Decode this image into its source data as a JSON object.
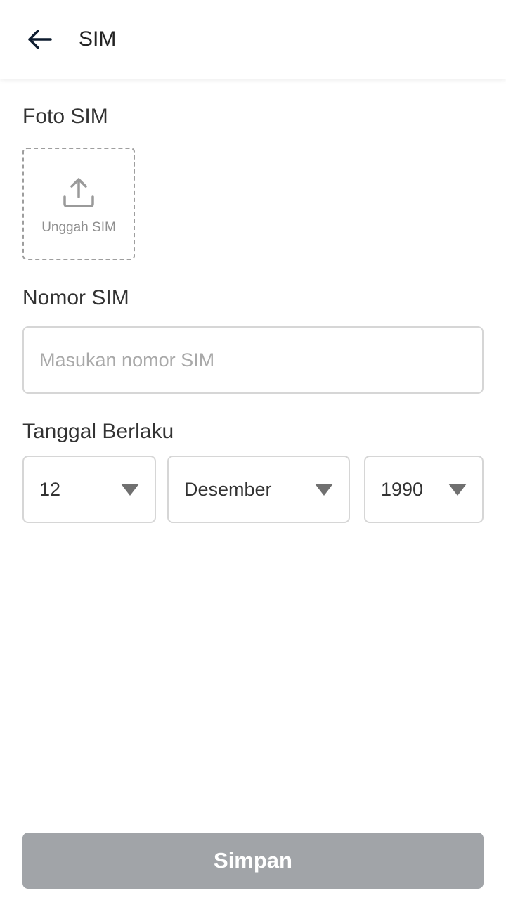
{
  "header": {
    "title": "SIM",
    "back_icon": "arrow-left-icon"
  },
  "photo": {
    "label": "Foto SIM",
    "upload_label": "Unggah SIM",
    "upload_icon": "upload-icon"
  },
  "number": {
    "label": "Nomor SIM",
    "value": "",
    "placeholder": "Masukan nomor SIM"
  },
  "validity": {
    "label": "Tanggal Berlaku",
    "day": "12",
    "month": "Desember",
    "year": "1990",
    "dropdown_icon": "caret-down-icon"
  },
  "save_button": {
    "label": "Simpan",
    "state": "disabled",
    "color": "#a1a4a8"
  },
  "colors": {
    "background": "#ffffff",
    "text": "#333333",
    "placeholder": "#a9a9a9",
    "border": "#d6d6d6",
    "icon": "#0d1b2e"
  }
}
